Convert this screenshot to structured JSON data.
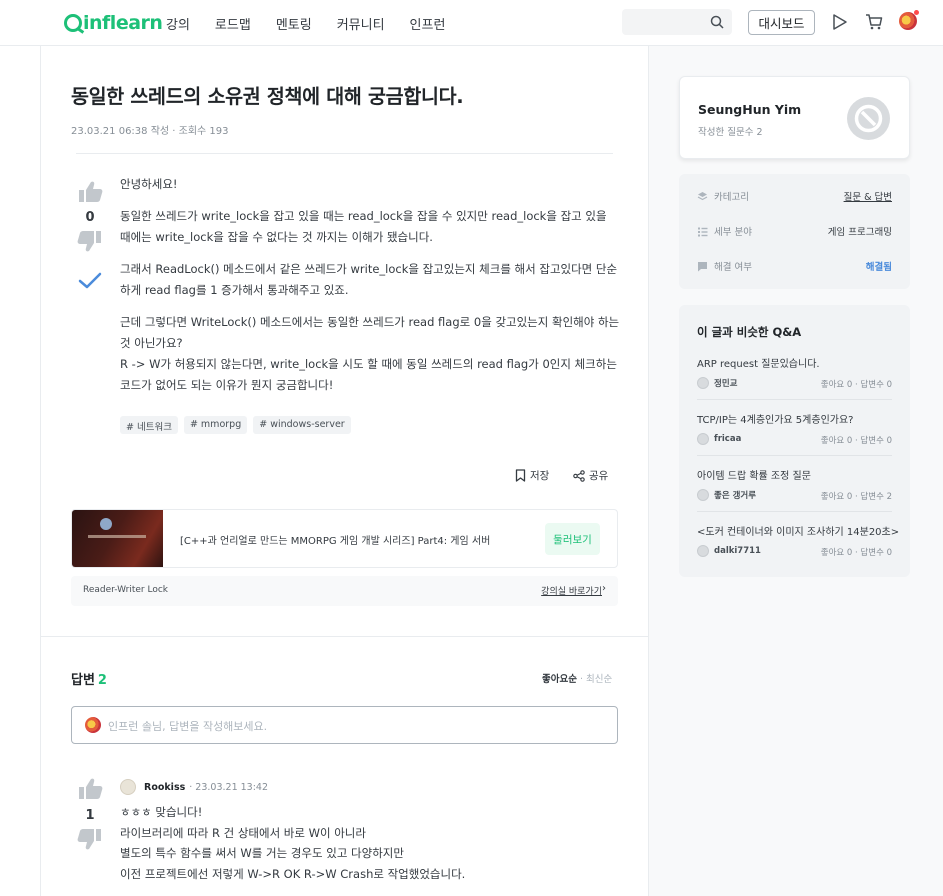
{
  "nav": {
    "logo": "inflearn",
    "menu": [
      "강의",
      "로드맵",
      "멘토링",
      "커뮤니티",
      "인프런"
    ],
    "dashboard_label": "대시보드",
    "icons": [
      "search-icon",
      "play-icon",
      "cart-icon",
      "avatar"
    ],
    "brand_color": "#1dc078"
  },
  "question": {
    "title": "동일한 쓰레드의 소유권 정책에 대해 궁금합니다.",
    "meta": "23.03.21 06:38 작성 · 조회수 193",
    "vote_count": "0",
    "paragraphs": [
      "안녕하세요!",
      "동일한 쓰레드가 write_lock을 잡고 있을 때는 read_lock을 잡을 수 있지만 read_lock을 잡고 있을 때에는 write_lock을 잡을 수 없다는 것 까지는 이해가 됐습니다.",
      "그래서 ReadLock() 메소드에서 같은 쓰레드가 write_lock을 잡고있는지 체크를 해서 잡고있다면 단순하게 read flag를 1 증가해서 통과해주고 있죠.",
      "근데 그렇다면 WriteLock() 메소드에서는 동일한 쓰레드가 read flag로 0을 갖고있는지 확인해야 하는 것 아닌가요?\nR -> W가 허용되지 않는다면, write_lock을 시도 할 때에 동일 쓰레드의 read flag가 0인지 체크하는 코드가 없어도 되는 이유가 뭔지 궁금합니다!"
    ],
    "tags": [
      "# 네트워크",
      "# mmorpg",
      "# windows-server"
    ],
    "save_label": "저장",
    "share_label": "공유"
  },
  "course": {
    "title": "[C++과 언리얼로 만드는 MMORPG 게임 개발 시리즈] Part4: 게임 서버",
    "button": "둘러보기",
    "lecture": "Reader-Writer Lock",
    "lecture_link": "강의실 바로가기"
  },
  "answers": {
    "heading": "답변",
    "count": "2",
    "sort_active": "좋아요순",
    "sort_sep": " · ",
    "sort_other": "최신순",
    "input_placeholder": "인프런 솔님, 답변을 작성해보세요.",
    "first": {
      "user": "Rookiss",
      "date": "· 23.03.21 13:42",
      "votes": "1",
      "lines": [
        "ㅎㅎㅎ 맞습니다!",
        "라이브러리에 따라 R 건 상태에서 바로 W이 아니라",
        "별도의 특수 함수를 써서 W를 거는 경우도 있고 다양하지만",
        "이전 프로젝트에선 저렇게 W->R OK R->W Crash로 작업했었습니다."
      ]
    }
  },
  "sidebar": {
    "author": {
      "name": "SeungHun Yim",
      "sub": "작성한 질문수 2"
    },
    "info": [
      {
        "icon": "layers-icon",
        "label": "카테고리",
        "value": "질문 & 답변",
        "style": "link"
      },
      {
        "icon": "list-icon",
        "label": "세부 분야",
        "value": "게임 프로그래밍",
        "style": "plain"
      },
      {
        "icon": "chat-icon",
        "label": "해결 여부",
        "value": "해결됨",
        "style": "ok"
      }
    ],
    "similar_heading": "이 글과 비슷한 Q&A",
    "similar": [
      {
        "title": "ARP request 질문있습니다.",
        "author": "정민교",
        "stat": "좋아요 0 · 답변수 0"
      },
      {
        "title": "TCP/IP는 4계층인가요 5계층인가요?",
        "author": "fricaa",
        "stat": "좋아요 0 · 답변수 0"
      },
      {
        "title": "아이템 드랍 확률 조정 질문",
        "author": "좋은 갱거루",
        "stat": "좋아요 0 · 답변수 2"
      },
      {
        "title": "<도커 컨테이너와 이미지 조사하기 14분20초>",
        "author": "dalki7711",
        "stat": "좋아요 0 · 답변수 0"
      }
    ]
  }
}
